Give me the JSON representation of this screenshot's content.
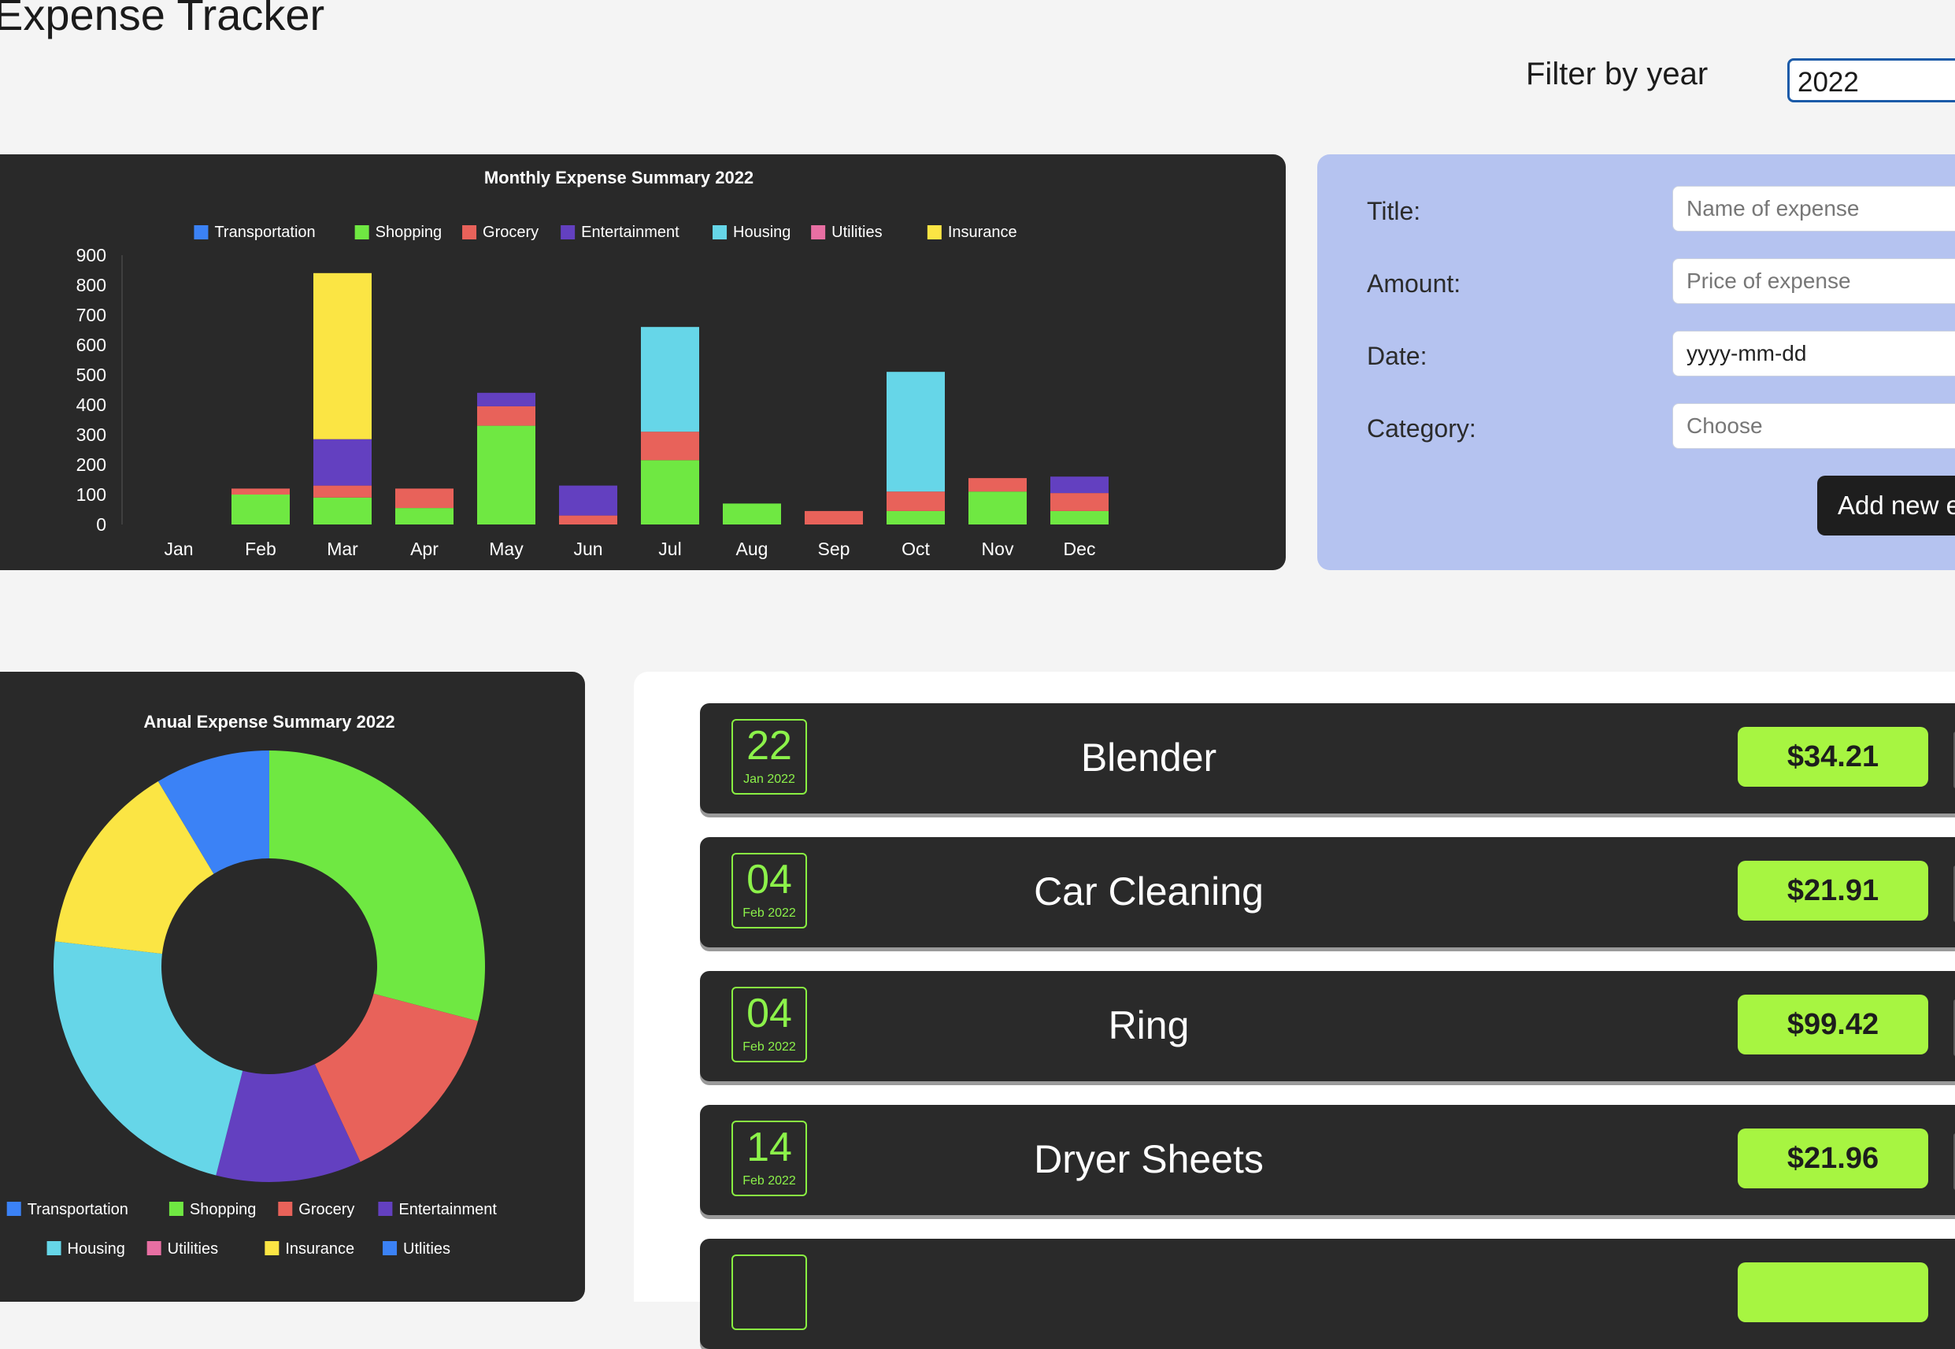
{
  "app": {
    "title": "Expense Tracker"
  },
  "filter": {
    "label": "Filter by year",
    "selected": "2022"
  },
  "form": {
    "fields": [
      {
        "label": "Title:",
        "placeholder": "Name of expense"
      },
      {
        "label": "Amount:",
        "placeholder": "Price of expense"
      },
      {
        "label": "Date:",
        "placeholder": "yyyy-mm-dd"
      },
      {
        "label": "Category:",
        "placeholder": "Choose"
      }
    ],
    "submit_label": "Add new expense"
  },
  "colors": {
    "Transportation": "#3b82f6",
    "Shopping": "#6fe842",
    "Grocery": "#e8625a",
    "Entertainment": "#6340c0",
    "Housing": "#66d6e8",
    "Utilities": "#e86fa3",
    "Insurance": "#fbe544",
    "accent_green": "#a7f541",
    "panel_dark": "#292929",
    "form_bg": "#b5c3f0"
  },
  "chart_data": [
    {
      "type": "bar",
      "stacked": true,
      "title": "Monthly Expense Summary 2022",
      "categories": [
        "Jan",
        "Feb",
        "Mar",
        "Apr",
        "May",
        "Jun",
        "Jul",
        "Aug",
        "Sep",
        "Oct",
        "Nov",
        "Dec"
      ],
      "ylim": [
        0,
        900
      ],
      "yticks": [
        0,
        100,
        200,
        300,
        400,
        500,
        600,
        700,
        800,
        900
      ],
      "legend": [
        "Transportation",
        "Shopping",
        "Grocery",
        "Entertainment",
        "Housing",
        "Utilities",
        "Insurance"
      ],
      "series": [
        {
          "name": "Transportation",
          "values": [
            0,
            0,
            0,
            0,
            0,
            0,
            0,
            0,
            0,
            0,
            0,
            0
          ]
        },
        {
          "name": "Shopping",
          "values": [
            0,
            100,
            90,
            55,
            330,
            0,
            215,
            70,
            0,
            45,
            110,
            45
          ]
        },
        {
          "name": "Grocery",
          "values": [
            0,
            20,
            40,
            65,
            65,
            30,
            95,
            0,
            45,
            65,
            45,
            60
          ]
        },
        {
          "name": "Entertainment",
          "values": [
            0,
            0,
            155,
            0,
            45,
            100,
            0,
            0,
            0,
            0,
            0,
            55
          ]
        },
        {
          "name": "Housing",
          "values": [
            0,
            0,
            0,
            0,
            0,
            0,
            350,
            0,
            0,
            400,
            0,
            0
          ]
        },
        {
          "name": "Utilities",
          "values": [
            0,
            0,
            0,
            0,
            0,
            0,
            0,
            0,
            0,
            0,
            0,
            0
          ]
        },
        {
          "name": "Insurance",
          "values": [
            0,
            0,
            555,
            0,
            0,
            0,
            0,
            0,
            0,
            0,
            0,
            0
          ]
        }
      ]
    },
    {
      "type": "pie",
      "donut": true,
      "title": "Anual Expense Summary 2022",
      "legend": [
        "Transportation",
        "Shopping",
        "Grocery",
        "Entertainment",
        "Housing",
        "Utilities",
        "Insurance",
        "Utlities"
      ],
      "slices": [
        {
          "label": "Shopping",
          "value": 30.4
        },
        {
          "label": "Grocery",
          "value": 14.6
        },
        {
          "label": "Entertainment",
          "value": 11.4
        },
        {
          "label": "Housing",
          "value": 23.9
        },
        {
          "label": "Insurance",
          "value": 15.2
        },
        {
          "label": "Transportation",
          "value": 9.0
        }
      ]
    }
  ],
  "expenses": [
    {
      "day": "22",
      "month": "Jan 2022",
      "title": "Blender",
      "amount": "$34.21"
    },
    {
      "day": "04",
      "month": "Feb 2022",
      "title": "Car Cleaning",
      "amount": "$21.91"
    },
    {
      "day": "04",
      "month": "Feb 2022",
      "title": "Ring",
      "amount": "$99.42"
    },
    {
      "day": "14",
      "month": "Feb 2022",
      "title": "Dryer Sheets",
      "amount": "$21.96"
    }
  ]
}
